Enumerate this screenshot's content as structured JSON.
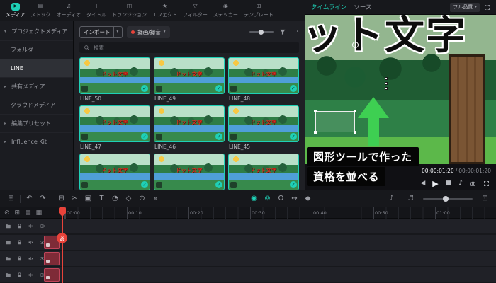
{
  "top_nav": {
    "items": [
      {
        "label": "メディア",
        "icon": "▶"
      },
      {
        "label": "ストック",
        "icon": "▤"
      },
      {
        "label": "オーディオ",
        "icon": "♫"
      },
      {
        "label": "タイトル",
        "icon": "T"
      },
      {
        "label": "トランジション",
        "icon": "◫"
      },
      {
        "label": "エフェクト",
        "icon": "★"
      },
      {
        "label": "フィルター",
        "icon": "▽"
      },
      {
        "label": "ステッカー",
        "icon": "◉"
      },
      {
        "label": "テンプレート",
        "icon": "⊞"
      }
    ]
  },
  "sidebar": {
    "items": [
      {
        "label": "プロジェクトメディア",
        "caret": "▾"
      },
      {
        "label": "フォルダ",
        "caret": ""
      },
      {
        "label": "LINE",
        "caret": ""
      },
      {
        "label": "共有メディア",
        "caret": "▸"
      },
      {
        "label": "クラウドメディア",
        "caret": ""
      },
      {
        "label": "編集プリセット",
        "caret": "▸"
      },
      {
        "label": "Influence Kit",
        "caret": "▸"
      }
    ]
  },
  "media_panel": {
    "import_label": "インポート",
    "import_caret": "▾",
    "record_label": "録画/録音",
    "record_caret": "▾",
    "more_icon": "⋯",
    "search_placeholder": "検索",
    "thumb_text": "ドット文字",
    "check_glyph": "✓",
    "items": [
      {
        "label": "LINE_50"
      },
      {
        "label": "LINE_49"
      },
      {
        "label": "LINE_48"
      },
      {
        "label": "LINE_47"
      },
      {
        "label": "LINE_46"
      },
      {
        "label": "LINE_45"
      },
      {
        "label": ""
      },
      {
        "label": ""
      },
      {
        "label": ""
      }
    ]
  },
  "preview": {
    "tab_timeline": "タイムライン",
    "tab_source": "ソース",
    "quality_label": "フル品質",
    "quality_caret": "▾",
    "scene_text": "ット文字",
    "timecode_current": "00:00:01:20",
    "timecode_sep": " / ",
    "timecode_total": "00:00:01:20",
    "annotation_line1": "図形ツールで作った",
    "annotation_line2": "資格を並べる",
    "controls": {
      "prev": "◀",
      "play": "▶",
      "stop": "■",
      "volume": "♪"
    }
  },
  "timeline": {
    "toolbar": [
      {
        "name": "media-grid",
        "glyph": "⊞"
      },
      {
        "name": "undo",
        "glyph": "↶"
      },
      {
        "name": "redo",
        "glyph": "↷"
      },
      {
        "name": "delete",
        "glyph": "⊟"
      },
      {
        "name": "split",
        "glyph": "✂"
      },
      {
        "name": "crop",
        "glyph": "▣"
      },
      {
        "name": "text",
        "glyph": "T"
      },
      {
        "name": "speed",
        "glyph": "◔"
      },
      {
        "name": "keyframe",
        "glyph": "◇"
      },
      {
        "name": "record-toggle",
        "glyph": "⊙"
      },
      {
        "name": "more",
        "glyph": "»"
      },
      {
        "name": "ripple",
        "glyph": "◉"
      },
      {
        "name": "auto-sync",
        "glyph": "⊚"
      },
      {
        "name": "magnet",
        "glyph": "Ω"
      },
      {
        "name": "move",
        "glyph": "↔"
      },
      {
        "name": "add-keyframe",
        "glyph": "◆"
      },
      {
        "name": "mixer",
        "glyph": "♪"
      },
      {
        "name": "audio",
        "glyph": "♬"
      },
      {
        "name": "fit",
        "glyph": "⊡"
      }
    ],
    "ruler_icons": [
      "⊘",
      "⊞",
      "▤",
      "▦"
    ],
    "ruler_labels": [
      "00:00",
      "00:10",
      "00:20",
      "00:30",
      "00:40",
      "00:50",
      "01:00"
    ]
  }
}
